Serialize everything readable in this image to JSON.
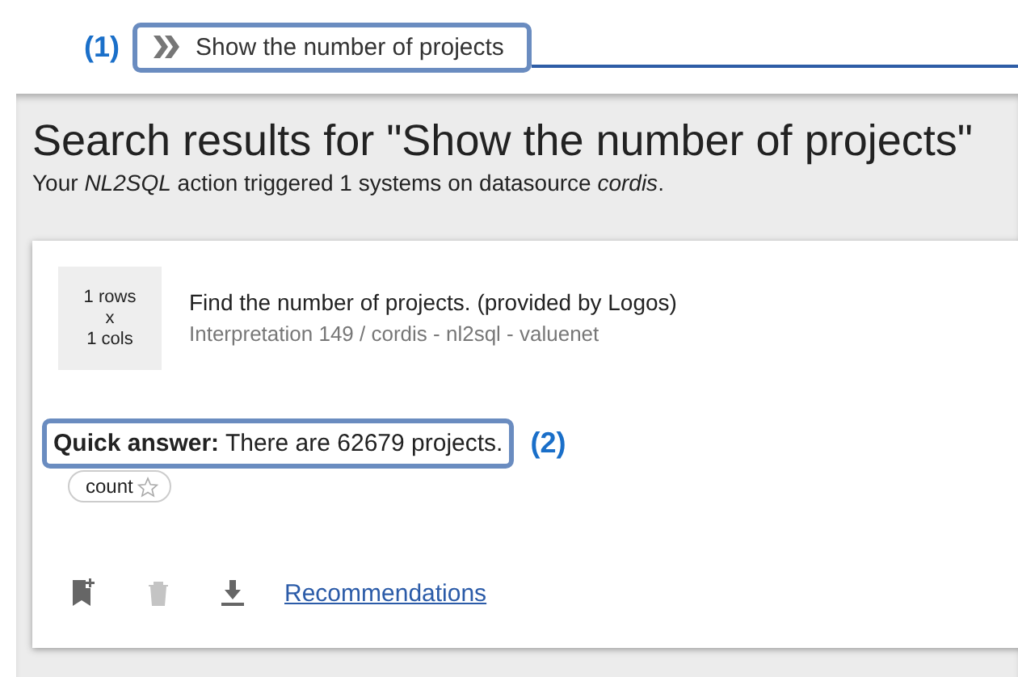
{
  "query_bar": {
    "annotation": "(1)",
    "value": "Show the number of projects"
  },
  "results": {
    "title": "Search results for \"Show the number of projects\"",
    "subtitle": "Your *NL2SQL* action triggered 1 systems on datasource *cordis*."
  },
  "card": {
    "size_rows": "1 rows",
    "size_x": "x",
    "size_cols": "1 cols",
    "heading": "Find the number of projects. (provided by Logos)",
    "meta": "Interpretation 149 / cordis - nl2sql - valuenet",
    "answer": "**Quick answer:** There are 62679 projects.",
    "answer_annotation": "(2)",
    "tags": [
      {
        "label": "count",
        "starred": false
      }
    ],
    "actions": [
      {
        "kind": "bookmark",
        "disabled": false
      },
      {
        "kind": "delete",
        "disabled": true
      },
      {
        "kind": "download",
        "disabled": false
      }
    ],
    "link": "Recommendations"
  }
}
